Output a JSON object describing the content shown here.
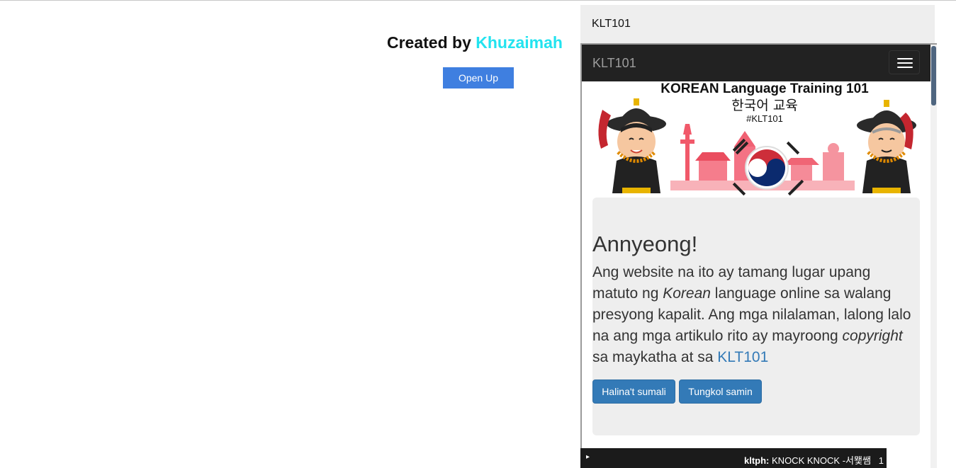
{
  "page": {
    "credit_prefix": "Created by",
    "credit_author": "Khuzaimah",
    "open_button": "Open Up"
  },
  "preview": {
    "title": "KLT101",
    "navbar": {
      "brand": "KLT101",
      "toggle_icon": "hamburger-menu-icon"
    },
    "banner": {
      "title": "KOREAN Language Training 101",
      "subtitle": "한국어 교육",
      "hashtag": "#KLT101"
    },
    "jumbotron": {
      "heading": "Annyeong!",
      "text_1": "Ang website na ito ay tamang lugar upang matuto ng ",
      "text_em_1": "Korean",
      "text_2": " language online sa walang presyong kapalit. Ang mga nilalaman, lalong lalo na ang mga artikulo rito ay mayroong ",
      "text_em_2": "copyright",
      "text_3": " sa maykatha at sa ",
      "link": "KLT101",
      "button_join": "Halina't sumali",
      "button_about": "Tungkol samin"
    },
    "ticker": {
      "user": "kltph:",
      "message": "KNOCK KNOCK -서뫷쌤",
      "count": "1"
    }
  },
  "colors": {
    "accent_author": "#22e3ef",
    "open_button": "#3f7fe0",
    "navbar": "#222222",
    "primary_button": "#337ab7",
    "jumbotron": "#eeeeee"
  }
}
